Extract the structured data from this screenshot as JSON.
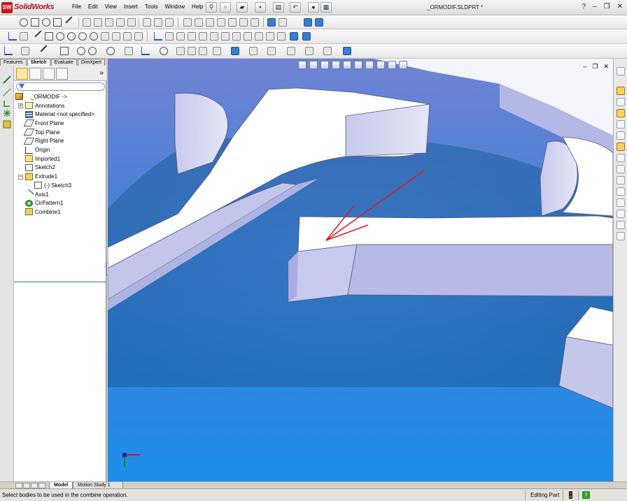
{
  "app": {
    "logo_text": "SolidWorks",
    "document_title": "_ORMODIF.SLDPRT *"
  },
  "menu": [
    "File",
    "Edit",
    "View",
    "Insert",
    "Tools",
    "Window",
    "Help"
  ],
  "window_controls": {
    "help": "?",
    "minimize": "–",
    "restore": "❐",
    "close": "✕"
  },
  "command_tabs": [
    "Features",
    "Sketch",
    "Evaluate",
    "DimXpert"
  ],
  "active_command_tab": "Sketch",
  "feature_tree": {
    "root": "_ORMODIF ->",
    "items": [
      {
        "label": "Annotations",
        "icon": "annotations-icon",
        "indent": 1,
        "expandable": true
      },
      {
        "label": "Material <not specified>",
        "icon": "material-icon",
        "indent": 1
      },
      {
        "label": "Front Plane",
        "icon": "plane-icon",
        "indent": 1
      },
      {
        "label": "Top Plane",
        "icon": "plane-icon",
        "indent": 1
      },
      {
        "label": "Right Plane",
        "icon": "plane-icon",
        "indent": 1
      },
      {
        "label": "Origin",
        "icon": "origin-icon",
        "indent": 1
      },
      {
        "label": "Imported1",
        "icon": "imported-body-icon",
        "indent": 1
      },
      {
        "label": "Sketch2",
        "icon": "sketch-icon",
        "indent": 1
      },
      {
        "label": "Extrude1",
        "icon": "extrude-icon",
        "indent": 1,
        "expandable": true,
        "expanded": true
      },
      {
        "label": "(-) Sketch3",
        "icon": "sketch-icon",
        "indent": 2
      },
      {
        "label": "Axis1",
        "icon": "axis-icon",
        "indent": 1
      },
      {
        "label": "CirPattern1",
        "icon": "circular-pattern-icon",
        "indent": 1
      },
      {
        "label": "Combine1",
        "icon": "combine-icon",
        "indent": 1
      }
    ]
  },
  "panel_chevron": "»",
  "viewport": {
    "window_controls": {
      "minimize": "–",
      "restore": "❐",
      "close": "✕"
    },
    "background_top": "#6f84d2",
    "background_bottom": "#1e8ee8",
    "annotation_arrow_color": "#e11818"
  },
  "bottom_tabs": [
    "Model",
    "Motion Study 1"
  ],
  "status": {
    "message": "Select bodies to be used in the combine operation.",
    "mode": "Editing Part"
  },
  "colors": {
    "brand_red": "#c8141c",
    "selection_blue": "#3a6fc4"
  }
}
